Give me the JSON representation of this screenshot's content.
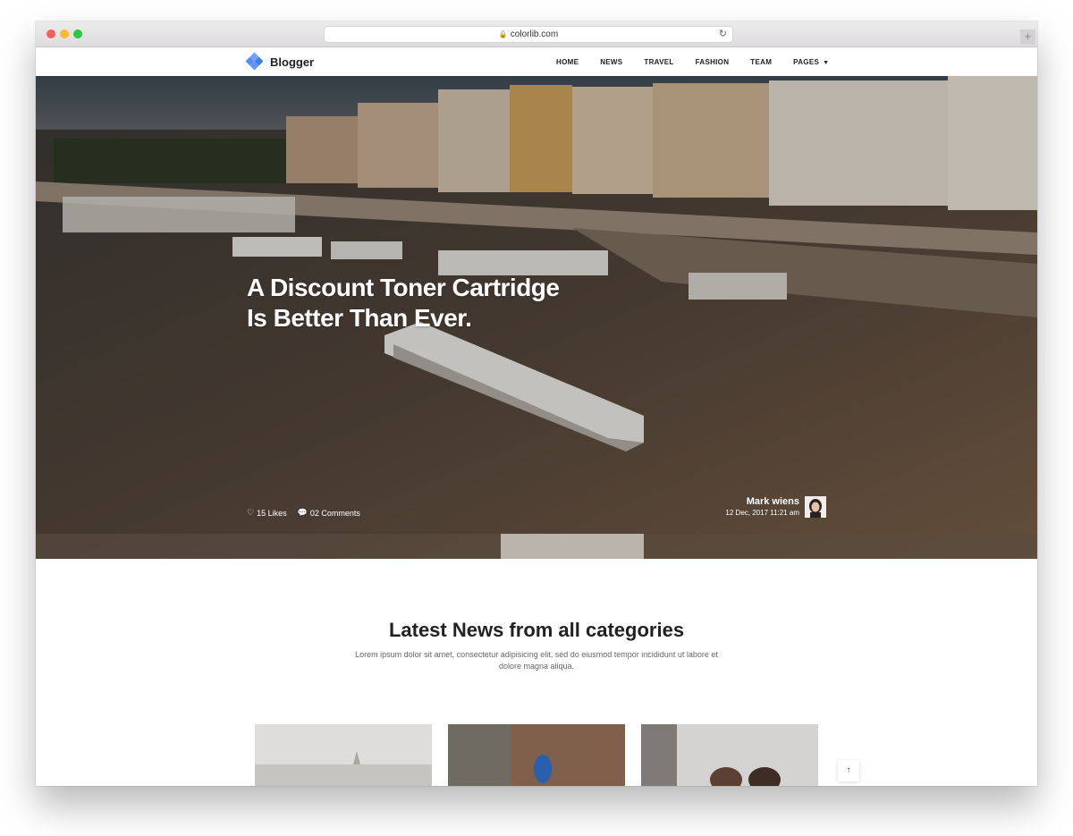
{
  "browser": {
    "url": "colorlib.com"
  },
  "nav": {
    "logo_text": "Blogger",
    "items": [
      {
        "label": "HOME"
      },
      {
        "label": "NEWS"
      },
      {
        "label": "TRAVEL"
      },
      {
        "label": "FASHION"
      },
      {
        "label": "TEAM"
      },
      {
        "label": "PAGES"
      }
    ]
  },
  "hero": {
    "title_line1": "A Discount Toner Cartridge",
    "title_line2": "Is Better Than Ever.",
    "likes": "15 Likes",
    "comments": "02 Comments",
    "author_name": "Mark wiens",
    "author_date": "12 Dec, 2017 11:21 am"
  },
  "news": {
    "heading": "Latest News from all categories",
    "subtitle": "Lorem ipsum dolor sit amet, consectetur adipisicing elit, sed do eiusmod tempor incididunt ut labore et dolore magna aliqua."
  },
  "colors": {
    "accent": "#4f8ff7",
    "text": "#222222"
  },
  "icons": {
    "likes": "heart-icon",
    "comments": "comment-icon",
    "scroll_top": "arrow-up-icon"
  }
}
